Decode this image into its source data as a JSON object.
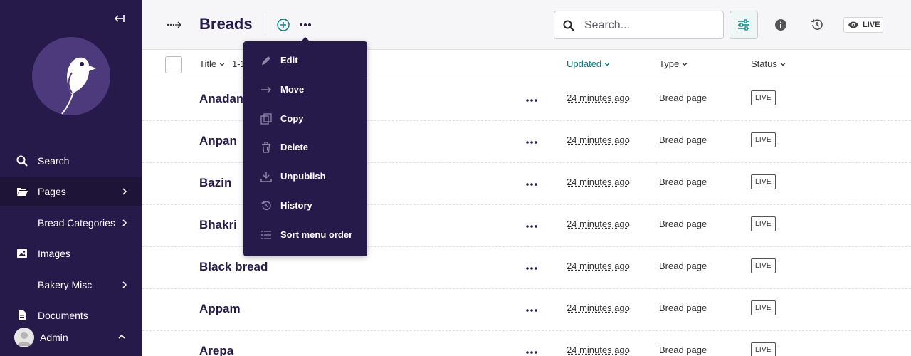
{
  "sidebar": {
    "collapse_label": "⇤",
    "items": [
      {
        "label": "Search"
      },
      {
        "label": "Pages"
      },
      {
        "label": "Bread Categories"
      },
      {
        "label": "Images"
      },
      {
        "label": "Bakery Misc"
      },
      {
        "label": "Documents"
      }
    ],
    "account": {
      "label": "Admin"
    }
  },
  "header": {
    "title": "Breads",
    "search_placeholder": "Search...",
    "live_label": "LIVE"
  },
  "table": {
    "columns": {
      "title": "Title",
      "count": "1-1",
      "updated": "Updated",
      "type": "Type",
      "status": "Status"
    },
    "rows": [
      {
        "title": "Anadama",
        "updated": "24 minutes ago",
        "type": "Bread page",
        "status": "LIVE"
      },
      {
        "title": "Anpan",
        "updated": "24 minutes ago",
        "type": "Bread page",
        "status": "LIVE"
      },
      {
        "title": "Bazin",
        "updated": "24 minutes ago",
        "type": "Bread page",
        "status": "LIVE"
      },
      {
        "title": "Bhakri",
        "updated": "24 minutes ago",
        "type": "Bread page",
        "status": "LIVE"
      },
      {
        "title": "Black bread",
        "updated": "24 minutes ago",
        "type": "Bread page",
        "status": "LIVE"
      },
      {
        "title": "Appam",
        "updated": "24 minutes ago",
        "type": "Bread page",
        "status": "LIVE"
      },
      {
        "title": "Arepa",
        "updated": "24 minutes ago",
        "type": "Bread page",
        "status": "LIVE"
      }
    ]
  },
  "dropdown": {
    "items": [
      {
        "label": "Edit",
        "icon": "pencil-icon"
      },
      {
        "label": "Move",
        "icon": "arrow-right-icon"
      },
      {
        "label": "Copy",
        "icon": "copy-icon"
      },
      {
        "label": "Delete",
        "icon": "trash-icon"
      },
      {
        "label": "Unpublish",
        "icon": "download-icon"
      },
      {
        "label": "History",
        "icon": "history-icon"
      },
      {
        "label": "Sort menu order",
        "icon": "list-icon"
      }
    ]
  },
  "colors": {
    "sidebar_bg": "#261a4b",
    "accent_teal": "#007d7e",
    "title_color": "#261a4b"
  }
}
